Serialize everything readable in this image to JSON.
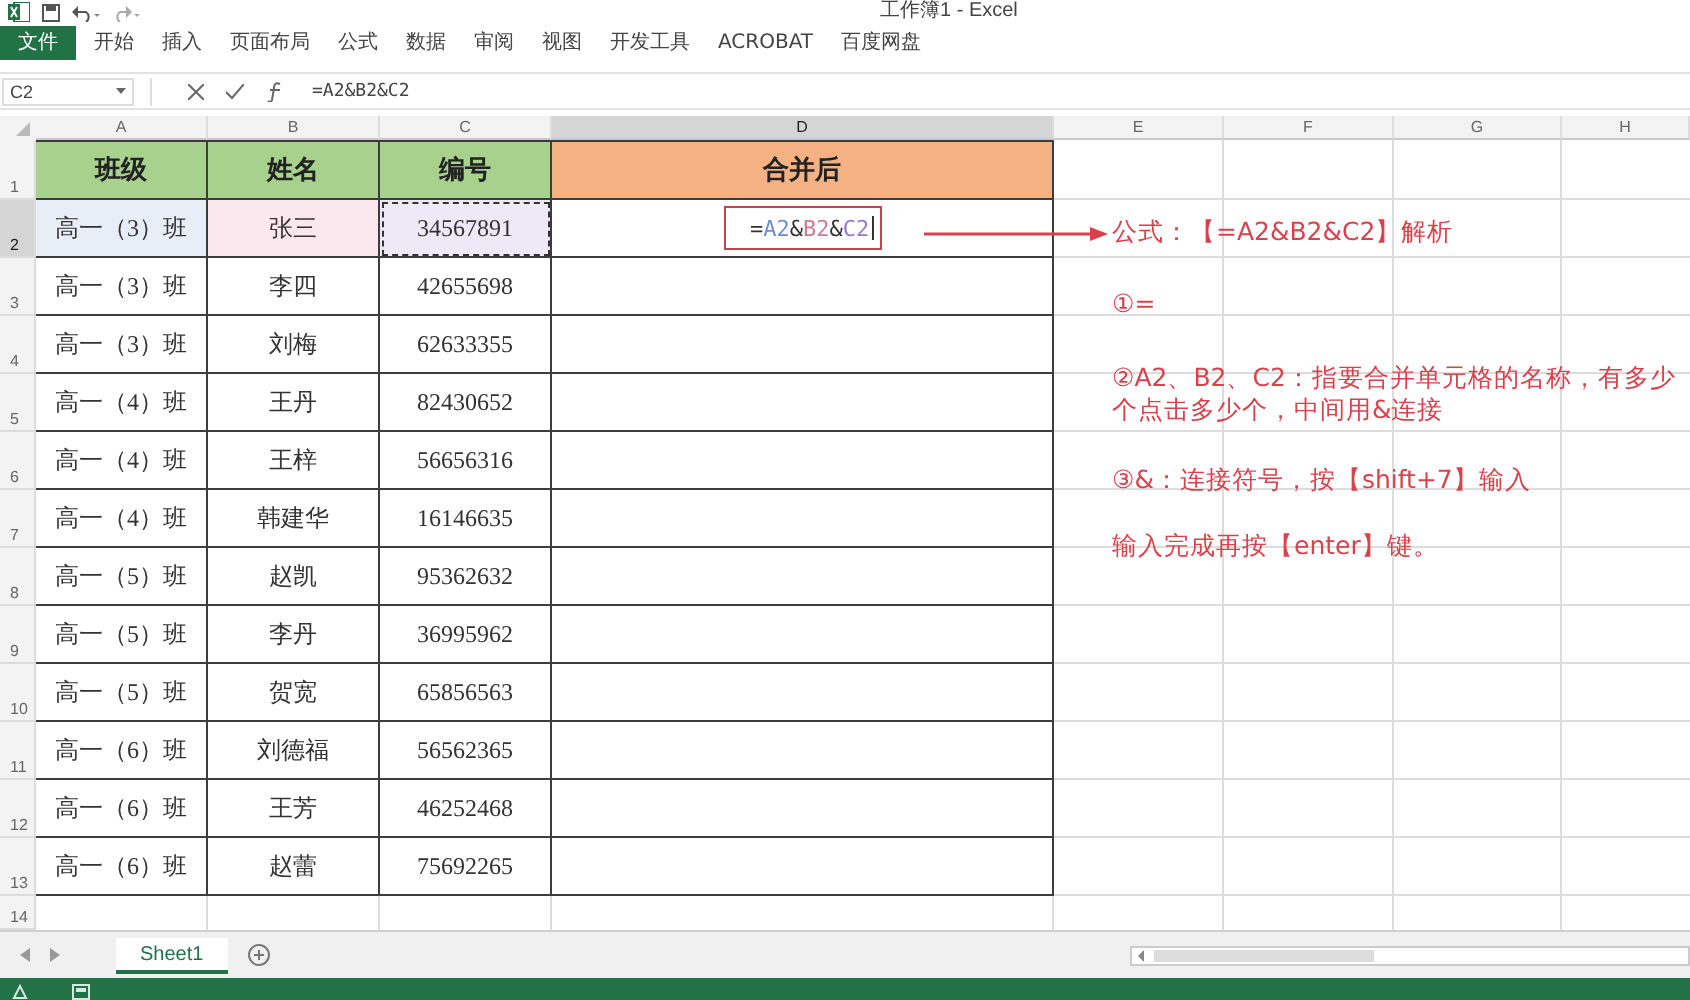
{
  "window": {
    "title": "工作簿1 - Excel"
  },
  "ribbon_tabs": [
    {
      "label": "文件",
      "kind": "file",
      "selected": false
    },
    {
      "label": "开始",
      "kind": "tab",
      "selected": false
    },
    {
      "label": "插入",
      "kind": "tab",
      "selected": false
    },
    {
      "label": "页面布局",
      "kind": "tab",
      "selected": false
    },
    {
      "label": "公式",
      "kind": "tab",
      "selected": false
    },
    {
      "label": "数据",
      "kind": "tab",
      "selected": false
    },
    {
      "label": "审阅",
      "kind": "tab",
      "selected": false
    },
    {
      "label": "视图",
      "kind": "tab",
      "selected": false
    },
    {
      "label": "开发工具",
      "kind": "tab",
      "selected": false
    },
    {
      "label": "ACROBAT",
      "kind": "tab",
      "selected": false
    },
    {
      "label": "百度网盘",
      "kind": "tab",
      "selected": false
    }
  ],
  "formula_bar": {
    "name_box": "C2",
    "formula": "=A2&B2&C2"
  },
  "columns": [
    {
      "label": "A",
      "selected": false
    },
    {
      "label": "B",
      "selected": false
    },
    {
      "label": "C",
      "selected": false
    },
    {
      "label": "D",
      "selected": true
    },
    {
      "label": "E",
      "selected": false
    },
    {
      "label": "F",
      "selected": false
    },
    {
      "label": "G",
      "selected": false
    },
    {
      "label": "H",
      "selected": false
    }
  ],
  "rows": [
    {
      "label": "1",
      "selected": false,
      "cells": [
        {
          "text": "班级",
          "kind": "header",
          "color": "#a9d18e"
        },
        {
          "text": "姓名",
          "kind": "header",
          "color": "#a9d18e"
        },
        {
          "text": "编号",
          "kind": "header",
          "color": "#a9d18e"
        },
        {
          "text": "合并后",
          "kind": "header",
          "color": "#f4b183"
        }
      ]
    },
    {
      "label": "2",
      "selected": true,
      "cells": [
        {
          "text": "高一（3）班",
          "kind": "ref",
          "color": "#e8eef8"
        },
        {
          "text": "张三",
          "kind": "ref",
          "color": "#fbe8ee"
        },
        {
          "text": "34567891",
          "kind": "copied",
          "color": "#eee9f6"
        },
        {
          "kind": "formula",
          "parts": [
            {
              "text": "=",
              "color": "#333333"
            },
            {
              "text": "A2",
              "color": "#6b8fd0"
            },
            {
              "text": "&",
              "color": "#333333"
            },
            {
              "text": "B2",
              "color": "#d07a96"
            },
            {
              "text": "&",
              "color": "#333333"
            },
            {
              "text": "C2",
              "color": "#9a7ac8"
            }
          ]
        }
      ]
    },
    {
      "label": "3",
      "selected": false,
      "cells": [
        {
          "text": "高一（3）班"
        },
        {
          "text": "李四"
        },
        {
          "text": "42655698"
        }
      ]
    },
    {
      "label": "4",
      "selected": false,
      "cells": [
        {
          "text": "高一（3）班"
        },
        {
          "text": "刘梅"
        },
        {
          "text": "62633355"
        }
      ]
    },
    {
      "label": "5",
      "selected": false,
      "cells": [
        {
          "text": "高一（4）班"
        },
        {
          "text": "王丹"
        },
        {
          "text": "82430652"
        }
      ]
    },
    {
      "label": "6",
      "selected": false,
      "cells": [
        {
          "text": "高一（4）班"
        },
        {
          "text": "王梓"
        },
        {
          "text": "56656316"
        }
      ]
    },
    {
      "label": "7",
      "selected": false,
      "cells": [
        {
          "text": "高一（4）班"
        },
        {
          "text": "韩建华"
        },
        {
          "text": "16146635"
        }
      ]
    },
    {
      "label": "8",
      "selected": false,
      "cells": [
        {
          "text": "高一（5）班"
        },
        {
          "text": "赵凯"
        },
        {
          "text": "95362632"
        }
      ]
    },
    {
      "label": "9",
      "selected": false,
      "cells": [
        {
          "text": "高一（5）班"
        },
        {
          "text": "李丹"
        },
        {
          "text": "36995962"
        }
      ]
    },
    {
      "label": "10",
      "selected": false,
      "cells": [
        {
          "text": "高一（5）班"
        },
        {
          "text": "贺宽"
        },
        {
          "text": "65856563"
        }
      ]
    },
    {
      "label": "11",
      "selected": false,
      "cells": [
        {
          "text": "高一（6）班"
        },
        {
          "text": "刘德福"
        },
        {
          "text": "56562365"
        }
      ]
    },
    {
      "label": "12",
      "selected": false,
      "cells": [
        {
          "text": "高一（6）班"
        },
        {
          "text": "王芳"
        },
        {
          "text": "46252468"
        }
      ]
    },
    {
      "label": "13",
      "selected": false,
      "cells": [
        {
          "text": "高一（6）班"
        },
        {
          "text": "赵蕾"
        },
        {
          "text": "75692265"
        }
      ]
    },
    {
      "label": "14",
      "selected": false,
      "cells": []
    }
  ],
  "annotations": [
    "公式：【=A2&B2&C2】解析",
    "①=",
    "②A2、B2、C2：指要合并单元格的名称，有多少个点击多少个，中间用&连接",
    "③&：连接符号，按【shift+7】输入",
    "输入完成再按【enter】键。"
  ],
  "sheet_tabs": [
    {
      "label": "Sheet1",
      "selected": true
    }
  ]
}
